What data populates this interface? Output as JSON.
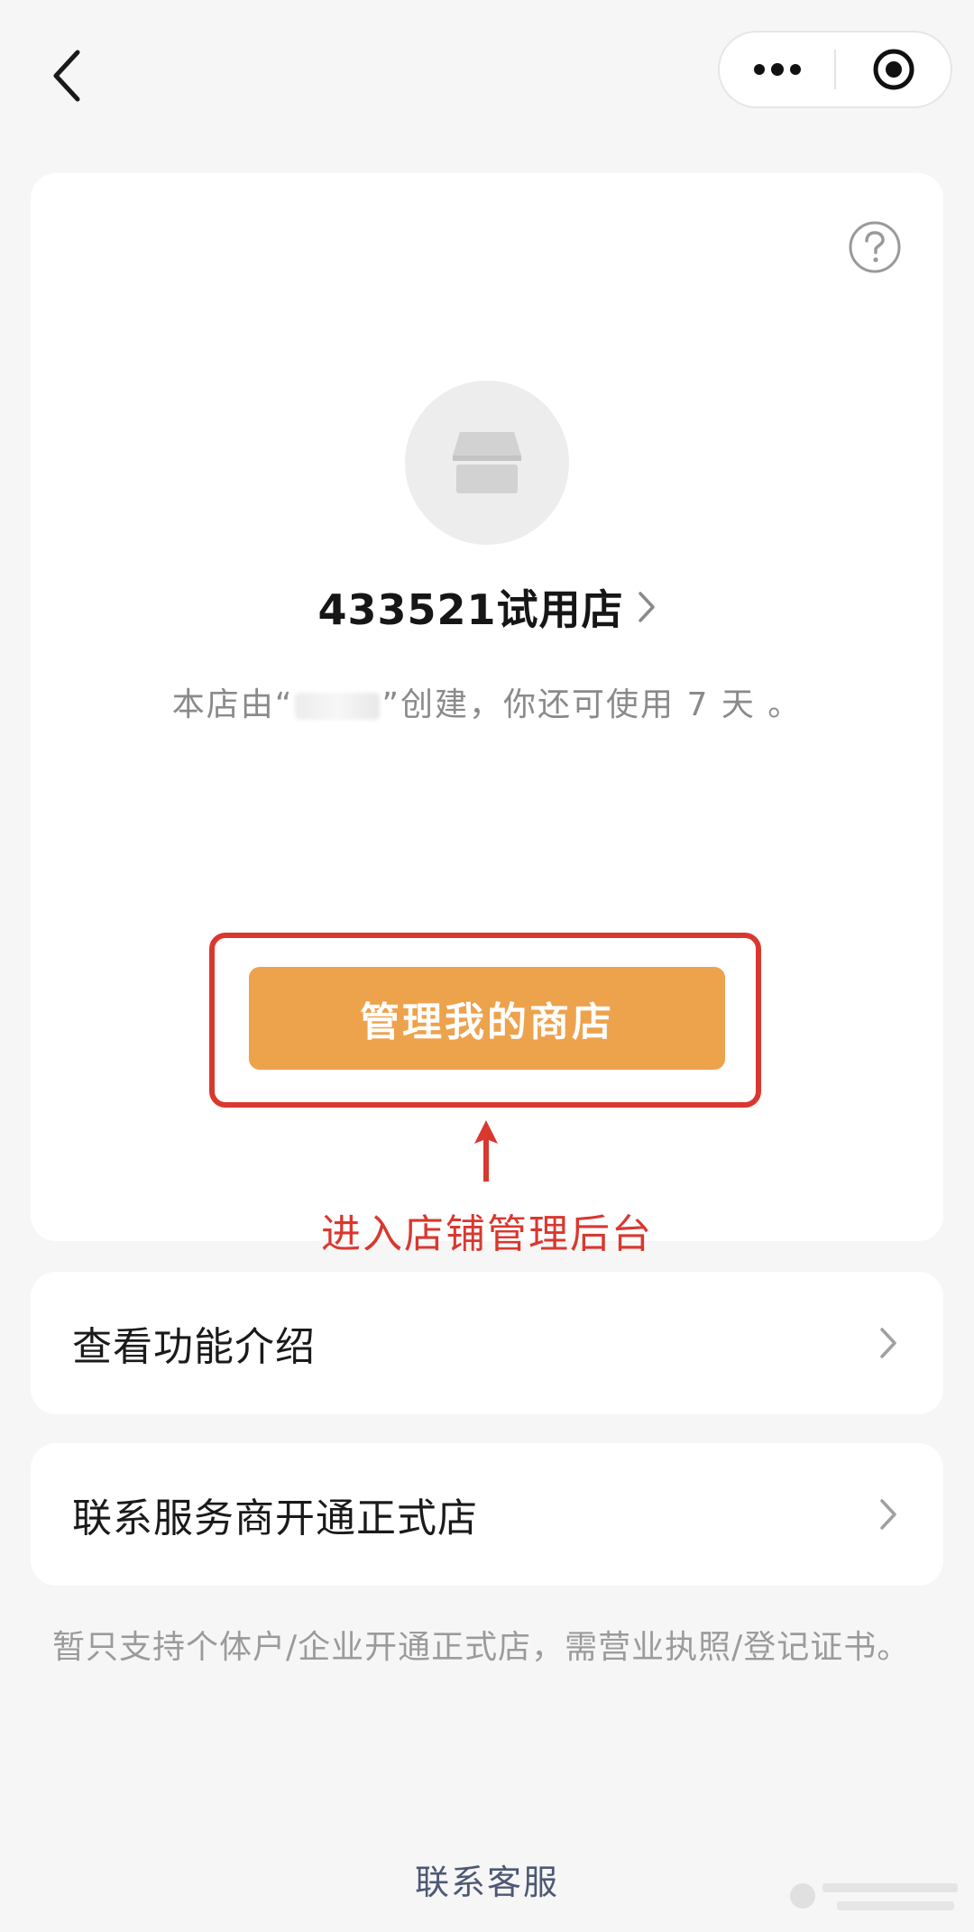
{
  "nav": {
    "back_icon": "chevron-left-icon",
    "menu_icon": "more-dots-icon",
    "close_icon": "target-circle-icon"
  },
  "store": {
    "help_icon": "question-circle-icon",
    "avatar_icon": "store-box-icon",
    "name": "433521试用店",
    "desc_prefix": "本店由“",
    "desc_suffix": "”创建，你还可使用 7 天 。"
  },
  "actions": {
    "manage_label": "管理我的商店"
  },
  "annotation": {
    "text": "进入店铺管理后台",
    "color": "#d9382f"
  },
  "list": [
    {
      "label": "查看功能介绍"
    },
    {
      "label": "联系服务商开通正式店"
    }
  ],
  "note": "暂只支持个体户/企业开通正式店，需营业执照/登记证书。",
  "footer": {
    "link": "联系客服"
  },
  "colors": {
    "accent": "#eda24c",
    "annotation": "#d9382f",
    "background": "#f6f6f6"
  }
}
